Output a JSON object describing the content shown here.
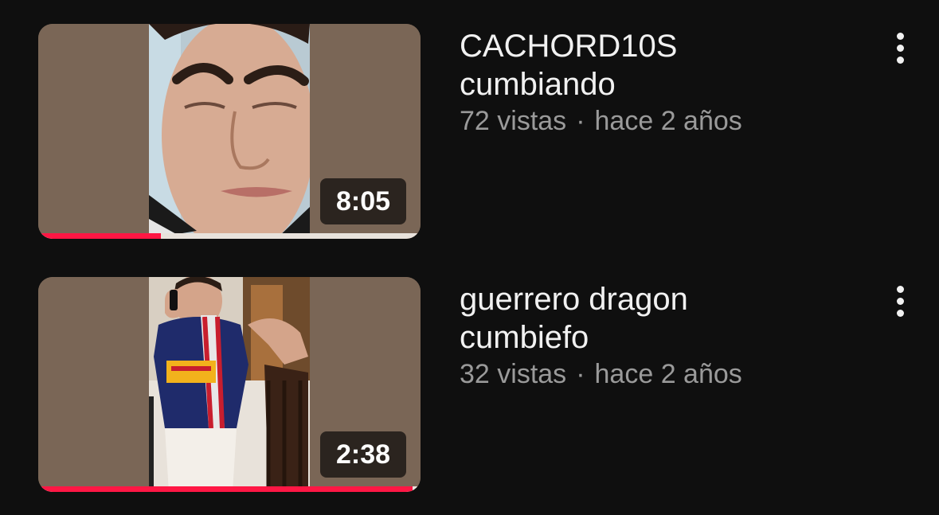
{
  "colors": {
    "background": "#0f0f0f",
    "title": "#f1f1f1",
    "meta": "#9a9a9a",
    "progress": "#ff1744"
  },
  "videos": [
    {
      "title_line1": "CACHORD10S",
      "title_line2": "cumbiando",
      "views": "72 vistas",
      "separator": "·",
      "age": "hace 2 años",
      "duration": "8:05",
      "watched_fraction": 0.32,
      "menu_icon": "more-vert-icon"
    },
    {
      "title_line1": "guerrero dragon",
      "title_line2": "cumbiefo",
      "views": "32 vistas",
      "separator": "·",
      "age": "hace 2 años",
      "duration": "2:38",
      "watched_fraction": 0.98,
      "menu_icon": "more-vert-icon"
    }
  ]
}
